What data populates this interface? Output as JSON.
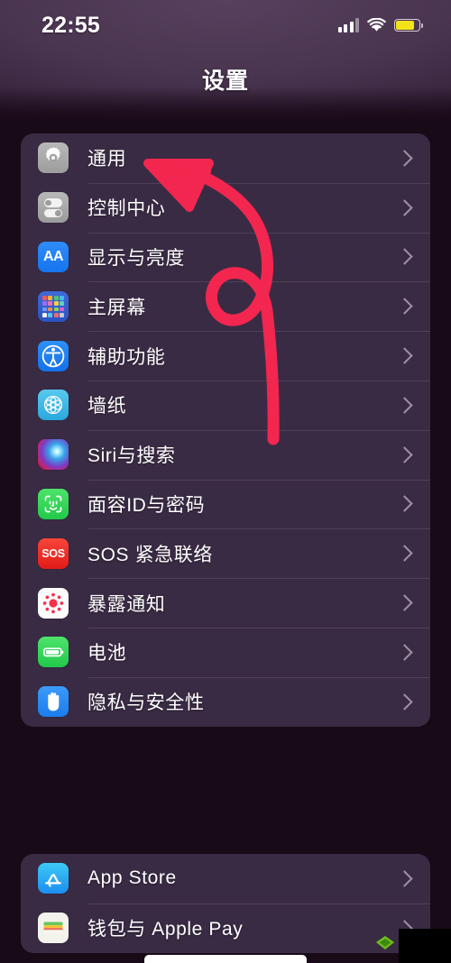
{
  "status_bar": {
    "time": "22:55",
    "signal_icon": "cellular-signal-icon",
    "wifi_icon": "wifi-icon",
    "battery_icon": "battery-icon",
    "battery_color": "#f2e319",
    "battery_level_pct": 73
  },
  "nav": {
    "title": "设置"
  },
  "groups": [
    {
      "rows": [
        {
          "label": "通用",
          "icon": "gear-icon",
          "accessory": "chevron-right-icon"
        },
        {
          "label": "控制中心",
          "icon": "toggles-icon",
          "accessory": "chevron-right-icon"
        },
        {
          "label": "显示与亮度",
          "icon": "aa-text-size-icon",
          "accessory": "chevron-right-icon"
        },
        {
          "label": "主屏幕",
          "icon": "home-screen-grid-icon",
          "accessory": "chevron-right-icon"
        },
        {
          "label": "辅助功能",
          "icon": "accessibility-icon",
          "accessory": "chevron-right-icon"
        },
        {
          "label": "墙纸",
          "icon": "wallpaper-flower-icon",
          "accessory": "chevron-right-icon"
        },
        {
          "label": "Siri与搜索",
          "icon": "siri-orb-icon",
          "accessory": "chevron-right-icon"
        },
        {
          "label": "面容ID与密码",
          "icon": "face-id-icon",
          "accessory": "chevron-right-icon"
        },
        {
          "label": "SOS 紧急联络",
          "icon": "sos-icon",
          "accessory": "chevron-right-icon"
        },
        {
          "label": "暴露通知",
          "icon": "exposure-notification-icon",
          "accessory": "chevron-right-icon"
        },
        {
          "label": "电池",
          "icon": "battery-settings-icon",
          "accessory": "chevron-right-icon"
        },
        {
          "label": "隐私与安全性",
          "icon": "privacy-hand-icon",
          "accessory": "chevron-right-icon"
        }
      ]
    },
    {
      "rows": [
        {
          "label": "App Store",
          "icon": "app-store-icon",
          "accessory": "chevron-right-icon"
        },
        {
          "label": "钱包与 Apple Pay",
          "icon": "wallet-icon",
          "accessory": "chevron-right-icon"
        }
      ]
    }
  ],
  "annotation": {
    "type": "hand-drawn-arrow",
    "color": "#f3264f",
    "points_to": "通用"
  },
  "colors": {
    "page_background": "#190a18",
    "card_background": "#3a2b44",
    "label_text": "#ffffff",
    "chevron": "#b0a3b6",
    "divider": "rgba(255,255,255,0.10)"
  }
}
